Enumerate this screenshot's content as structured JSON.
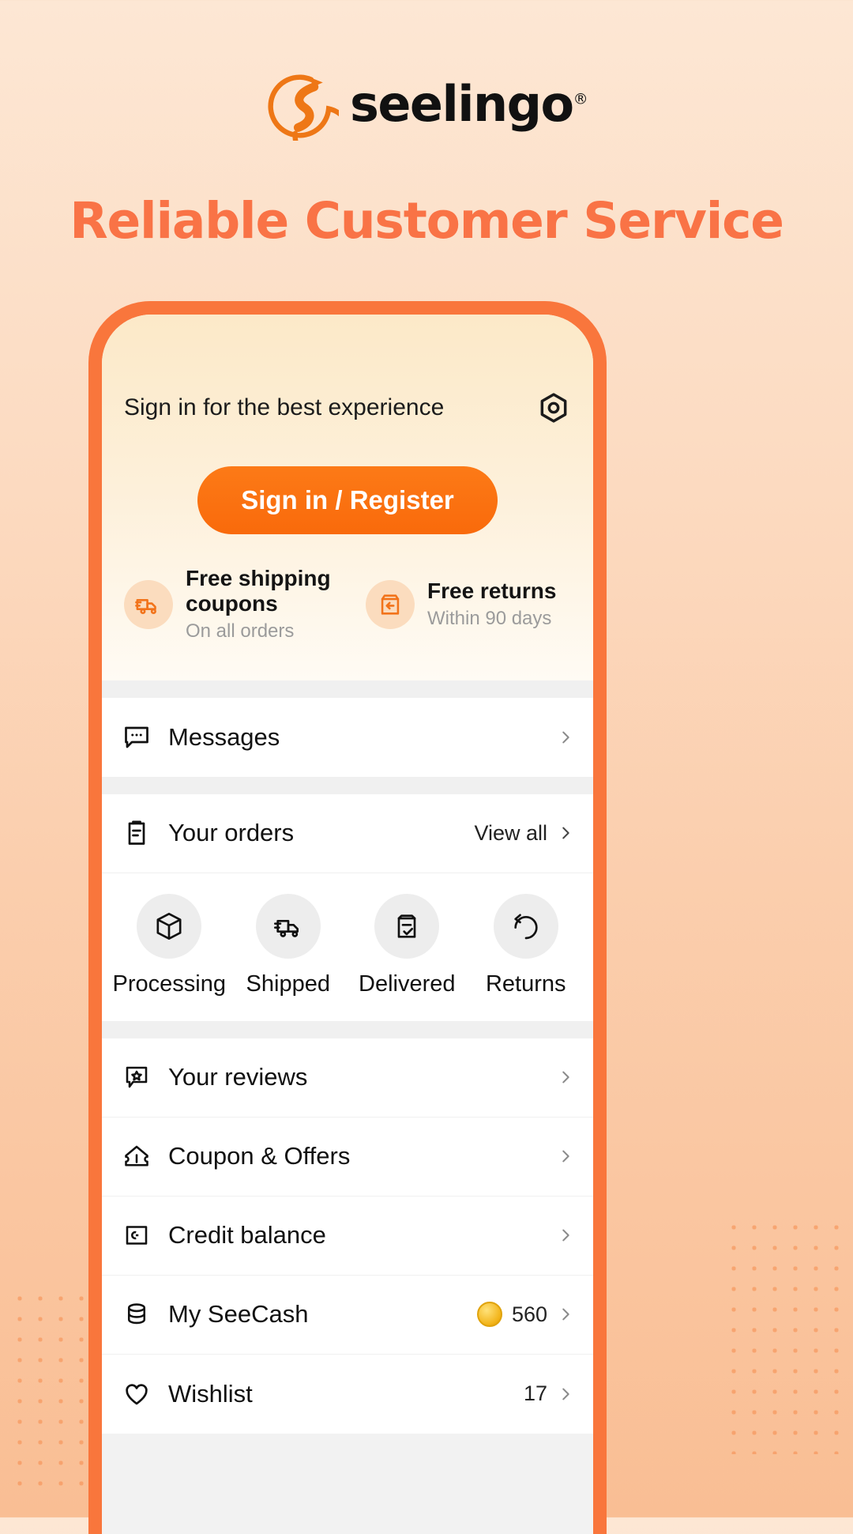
{
  "brand": {
    "name": "seelingo",
    "registered": "®",
    "mark_icon": "seelingo-swirl-logo"
  },
  "headline": "Reliable Customer Service",
  "phone": {
    "hero": {
      "signin_prompt": "Sign in for the best experience",
      "settings_icon": "hex-nut-settings-icon",
      "cta_label": "Sign in / Register",
      "benefits": [
        {
          "icon": "delivery-truck-icon",
          "title": "Free shipping coupons",
          "subtitle": "On all orders"
        },
        {
          "icon": "return-box-icon",
          "title": "Free returns",
          "subtitle": "Within 90 days"
        }
      ]
    },
    "messages": {
      "icon": "chat-bubble-icon",
      "label": "Messages",
      "chevron": "chevron-right-icon"
    },
    "orders": {
      "icon": "clipboard-icon",
      "label": "Your orders",
      "view_all": "View all",
      "statuses": [
        {
          "icon": "package-box-icon",
          "label": "Processing"
        },
        {
          "icon": "shipping-truck-icon",
          "label": "Shipped"
        },
        {
          "icon": "delivered-check-icon",
          "label": "Delivered"
        },
        {
          "icon": "return-arrow-icon",
          "label": "Returns"
        }
      ]
    },
    "menu": [
      {
        "icon": "review-star-icon",
        "label": "Your reviews",
        "value": ""
      },
      {
        "icon": "coupon-ticket-icon",
        "label": "Coupon & Offers",
        "value": ""
      },
      {
        "icon": "credit-wallet-icon",
        "label": "Credit balance",
        "value": ""
      },
      {
        "icon": "coins-stack-icon",
        "label": "My SeeCash",
        "value": "560",
        "has_coin": true
      },
      {
        "icon": "heart-icon",
        "label": "Wishlist",
        "value": "17"
      }
    ]
  },
  "colors": {
    "brand_orange": "#F97346",
    "cta_orange": "#F96A0B",
    "phone_frame": "#F9763C",
    "page_bg_top": "#FDE7D4",
    "page_bg_bottom": "#F9BE94"
  }
}
